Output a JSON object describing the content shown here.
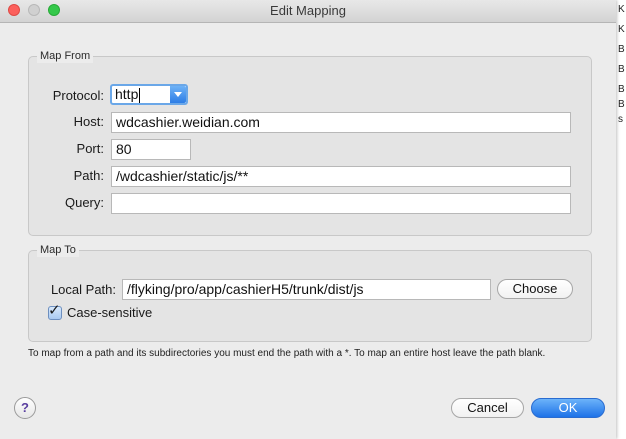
{
  "window": {
    "title": "Edit Mapping"
  },
  "map_from": {
    "group_title": "Map From",
    "protocol_label": "Protocol:",
    "protocol_value": "http",
    "host_label": "Host:",
    "host_value": "wdcashier.weidian.com",
    "port_label": "Port:",
    "port_value": "80",
    "path_label": "Path:",
    "path_value": "/wdcashier/static/js/**",
    "query_label": "Query:",
    "query_value": ""
  },
  "map_to": {
    "group_title": "Map To",
    "local_path_label": "Local Path:",
    "local_path_value": "/flyking/pro/app/cashierH5/trunk/dist/js",
    "choose_label": "Choose",
    "case_sensitive_label": "Case-sensitive",
    "case_sensitive_checked": true
  },
  "hint": "To map from a path and its subdirectories you must end the path with a *. To map an entire host leave the path blank.",
  "buttons": {
    "help": "?",
    "cancel": "Cancel",
    "ok": "OK"
  },
  "background_letters": [
    "K",
    "K",
    "B",
    "B",
    "B",
    "B",
    "s"
  ],
  "colors": {
    "close": "#fc605c",
    "zoom": "#34c84a",
    "accent": "#2d7de6"
  }
}
